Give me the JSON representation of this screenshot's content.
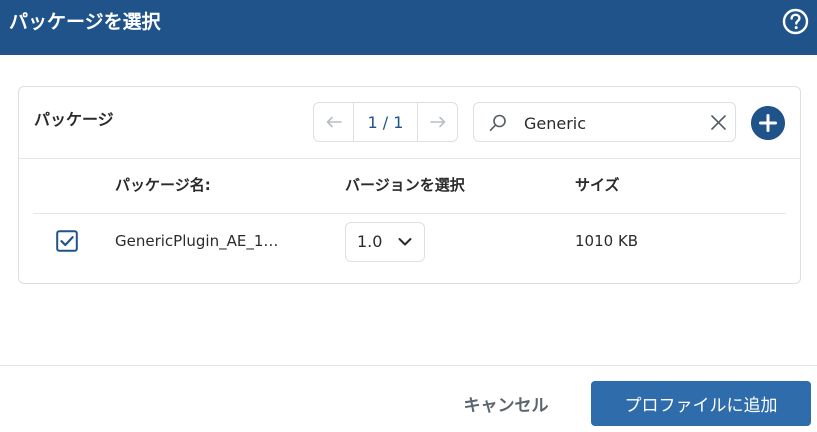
{
  "header": {
    "title": "パッケージを選択",
    "help_icon": "help-circle-icon"
  },
  "panel": {
    "title": "パッケージ",
    "pagination": {
      "prev_icon": "arrow-left-icon",
      "text": "1 / 1",
      "next_icon": "arrow-right-icon"
    },
    "search": {
      "icon": "search-icon",
      "value": "Generic",
      "clear_icon": "close-icon"
    },
    "add_button_icon": "plus-icon",
    "table": {
      "columns": [
        "パッケージ名:",
        "バージョンを選択",
        "サイズ"
      ],
      "rows": [
        {
          "checked": true,
          "name": "GenericPlugin_AE_1…",
          "version": "1.0",
          "size": "1010 KB"
        }
      ]
    }
  },
  "footer": {
    "cancel_label": "キャンセル",
    "primary_label": "プロファイルに追加"
  },
  "colors": {
    "header_bg": "#1f5389",
    "primary_button": "#2f6cab",
    "accent": "#1f5389"
  }
}
